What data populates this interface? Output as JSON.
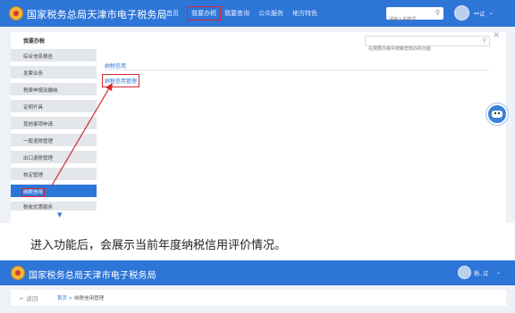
{
  "site_title": "国家税务总局天津市电子税务局",
  "nav": [
    "首页",
    "我要办税",
    "我要查询",
    "公众服务",
    "地方特色"
  ],
  "nav_active": "我要办税",
  "header_search_placeholder": "请输入关键词",
  "user_name": "**试",
  "sidebar": {
    "title": "我要办税",
    "items": [
      "综合信息报告",
      "发票业务",
      "税费申报及缴纳",
      "证明开具",
      "其他事项申请",
      "一般退税管理",
      "出口退税管理",
      "核定管理",
      "纳税信用",
      "税收优惠服务"
    ],
    "active": "纳税信用"
  },
  "main": {
    "search_placeholder": "在我要办税中搜索您想办的功能",
    "section_label": "纳税信用",
    "link": "纳税信用管理"
  },
  "caption": "进入功能后，会展示当前年度纳税信用评价情况。",
  "second": {
    "site_title": "国家税务总局天津市电子税务局",
    "user_name": "杨..试",
    "back_label": "← 返回",
    "breadcrumb": [
      "首页",
      "纳税信用管理"
    ]
  },
  "colors": {
    "brand": "#2e75d8",
    "highlight": "#d6262b"
  }
}
